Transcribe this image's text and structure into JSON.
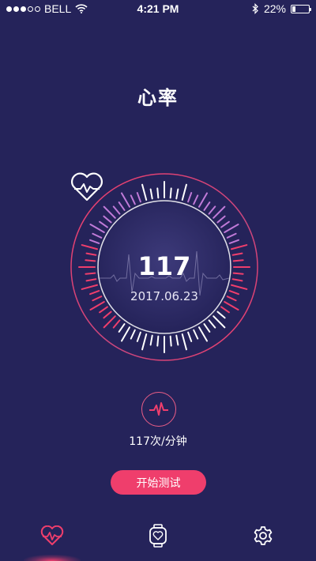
{
  "status_bar": {
    "carrier": "BELL",
    "time": "4:21 PM",
    "battery_percent": "22%",
    "battery_level": 0.22,
    "signal_bars_filled": 3,
    "signal_bars_total": 5,
    "icons": [
      "wifi-icon",
      "bluetooth-icon",
      "battery-icon"
    ]
  },
  "header": {
    "title": "心率"
  },
  "dial": {
    "bpm": "117",
    "date": "2017.06.23",
    "icon": "heart-icon"
  },
  "summary": {
    "rate_text": "117次/分钟",
    "icon": "pulse-icon"
  },
  "actions": {
    "start_label": "开始测试"
  },
  "tabs": [
    {
      "name": "heart-rate",
      "icon": "heart-icon",
      "active": true
    },
    {
      "name": "watch",
      "icon": "watch-icon",
      "active": false
    },
    {
      "name": "settings",
      "icon": "gear-icon",
      "active": false
    }
  ],
  "colors": {
    "background": "#25235a",
    "accent": "#ef3e6c",
    "tick_light": "#ffffff",
    "tick_pink": "#ef3e6c",
    "tick_violet": "#c07ad8"
  }
}
